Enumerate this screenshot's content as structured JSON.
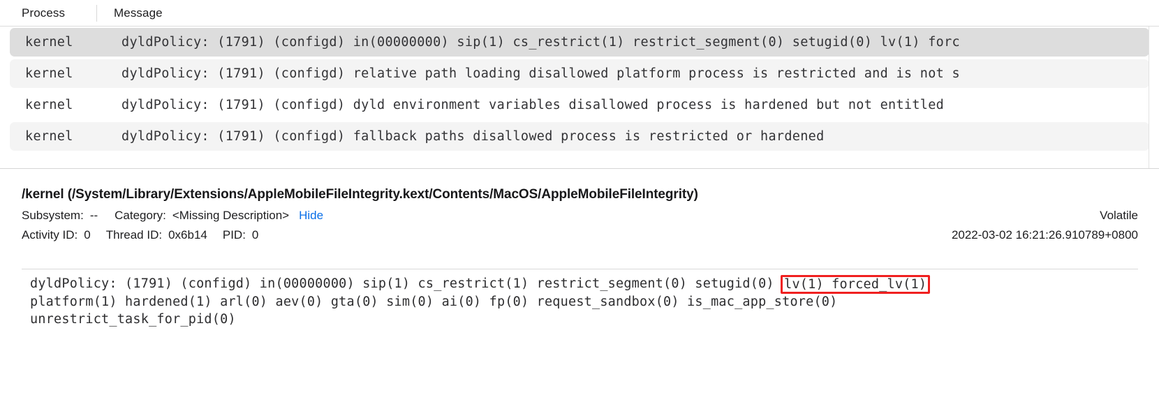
{
  "table": {
    "columns": [
      {
        "key": "process",
        "label": "Process"
      },
      {
        "key": "message",
        "label": "Message"
      }
    ],
    "rows": [
      {
        "process": "kernel",
        "message": "dyldPolicy: (1791) (configd) in(00000000) sip(1) cs_restrict(1) restrict_segment(0) setugid(0) lv(1) forc",
        "state": "selected"
      },
      {
        "process": "kernel",
        "message": "dyldPolicy: (1791) (configd) relative path loading disallowed platform process is restricted and is not s",
        "state": "stripe"
      },
      {
        "process": "kernel",
        "message": "dyldPolicy: (1791) (configd) dyld environment variables disallowed process is hardened but not entitled",
        "state": "plain"
      },
      {
        "process": "kernel",
        "message": "dyldPolicy: (1791) (configd) fallback paths disallowed process is restricted or hardened",
        "state": "stripe"
      }
    ]
  },
  "detail": {
    "title": "/kernel (/System/Library/Extensions/AppleMobileFileIntegrity.kext/Contents/MacOS/AppleMobileFileIntegrity)",
    "subsystem_label": "Subsystem:",
    "subsystem_value": "--",
    "category_label": "Category:",
    "category_value": "<Missing Description>",
    "hide_label": "Hide",
    "volatile_label": "Volatile",
    "activity_id_label": "Activity ID:",
    "activity_id_value": "0",
    "thread_id_label": "Thread ID:",
    "thread_id_value": "0x6b14",
    "pid_label": "PID:",
    "pid_value": "0",
    "timestamp": "2022-03-02 16:21:26.910789+0800",
    "message_body": {
      "line1_pre": "dyldPolicy: (1791) (configd) in(00000000) sip(1) cs_restrict(1) restrict_segment(0) setugid(0) ",
      "line1_highlight": "lv(1) forced_lv(1)",
      "line2": "platform(1) hardened(1) arl(0) aev(0) gta(0) sim(0) ai(0) fp(0) request_sandbox(0) is_mac_app_store(0)",
      "line3": "unrestrict_task_for_pid(0)"
    }
  },
  "colors": {
    "highlight_box": "#f02020",
    "link": "#0a6fe8",
    "selected_row": "#dddddd",
    "stripe_row": "#f4f4f4"
  }
}
